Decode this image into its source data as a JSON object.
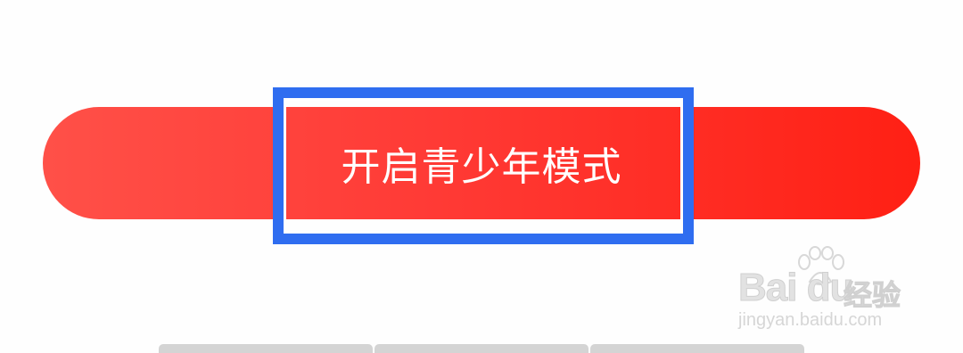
{
  "primary_button": {
    "label": "开启青少年模式",
    "gradient_start": "#ff5048",
    "gradient_end": "#ff2014",
    "text_color": "#ffffff"
  },
  "highlight": {
    "color": "#2f6df0"
  },
  "watermark": {
    "brand": "Bai du",
    "brand_cn": "经验",
    "url": "jingyan.baidu.com",
    "icon": "paw-icon"
  },
  "bottom_bar": {
    "segments": 3
  }
}
